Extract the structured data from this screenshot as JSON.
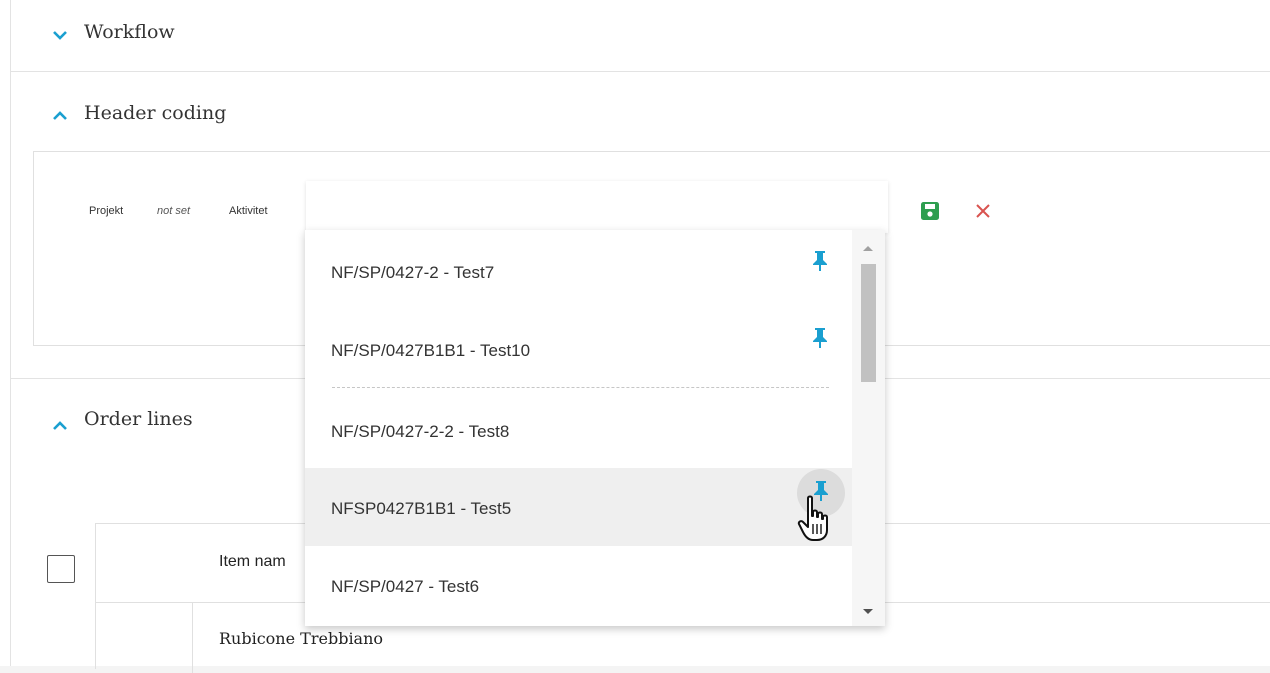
{
  "sections": {
    "workflow": {
      "title": "Workflow",
      "expanded": false
    },
    "header_coding": {
      "title": "Header coding",
      "expanded": true
    },
    "order_lines": {
      "title": "Order lines",
      "expanded": true
    }
  },
  "header_coding": {
    "projekt_label": "Projekt",
    "projekt_value": "not set",
    "aktivitet_label": "Aktivitet",
    "aktivitet_input_value": "",
    "save_icon": "floppy-disk-icon",
    "cancel_icon": "close-icon",
    "save_color": "#2e9e4f",
    "cancel_color": "#d9534f"
  },
  "dropdown": {
    "pinned_options": [
      {
        "label": "NF/SP/0427-2 - Test7",
        "pinned": true
      },
      {
        "label": "NF/SP/0427B1B1 - Test10",
        "pinned": true
      }
    ],
    "other_options": [
      {
        "label": "NF/SP/0427-2-2 - Test8",
        "pinned": false
      },
      {
        "label": "NFSP0427B1B1 - Test5",
        "pinned": false,
        "hovered": true
      },
      {
        "label": "NF/SP/0427 - Test6",
        "pinned": false
      }
    ],
    "pin_color": "#1a9fd0"
  },
  "order_lines": {
    "columns": [
      "Item nam"
    ],
    "rows": [
      {
        "item_name": "Rubicone Trebbiano"
      }
    ]
  }
}
